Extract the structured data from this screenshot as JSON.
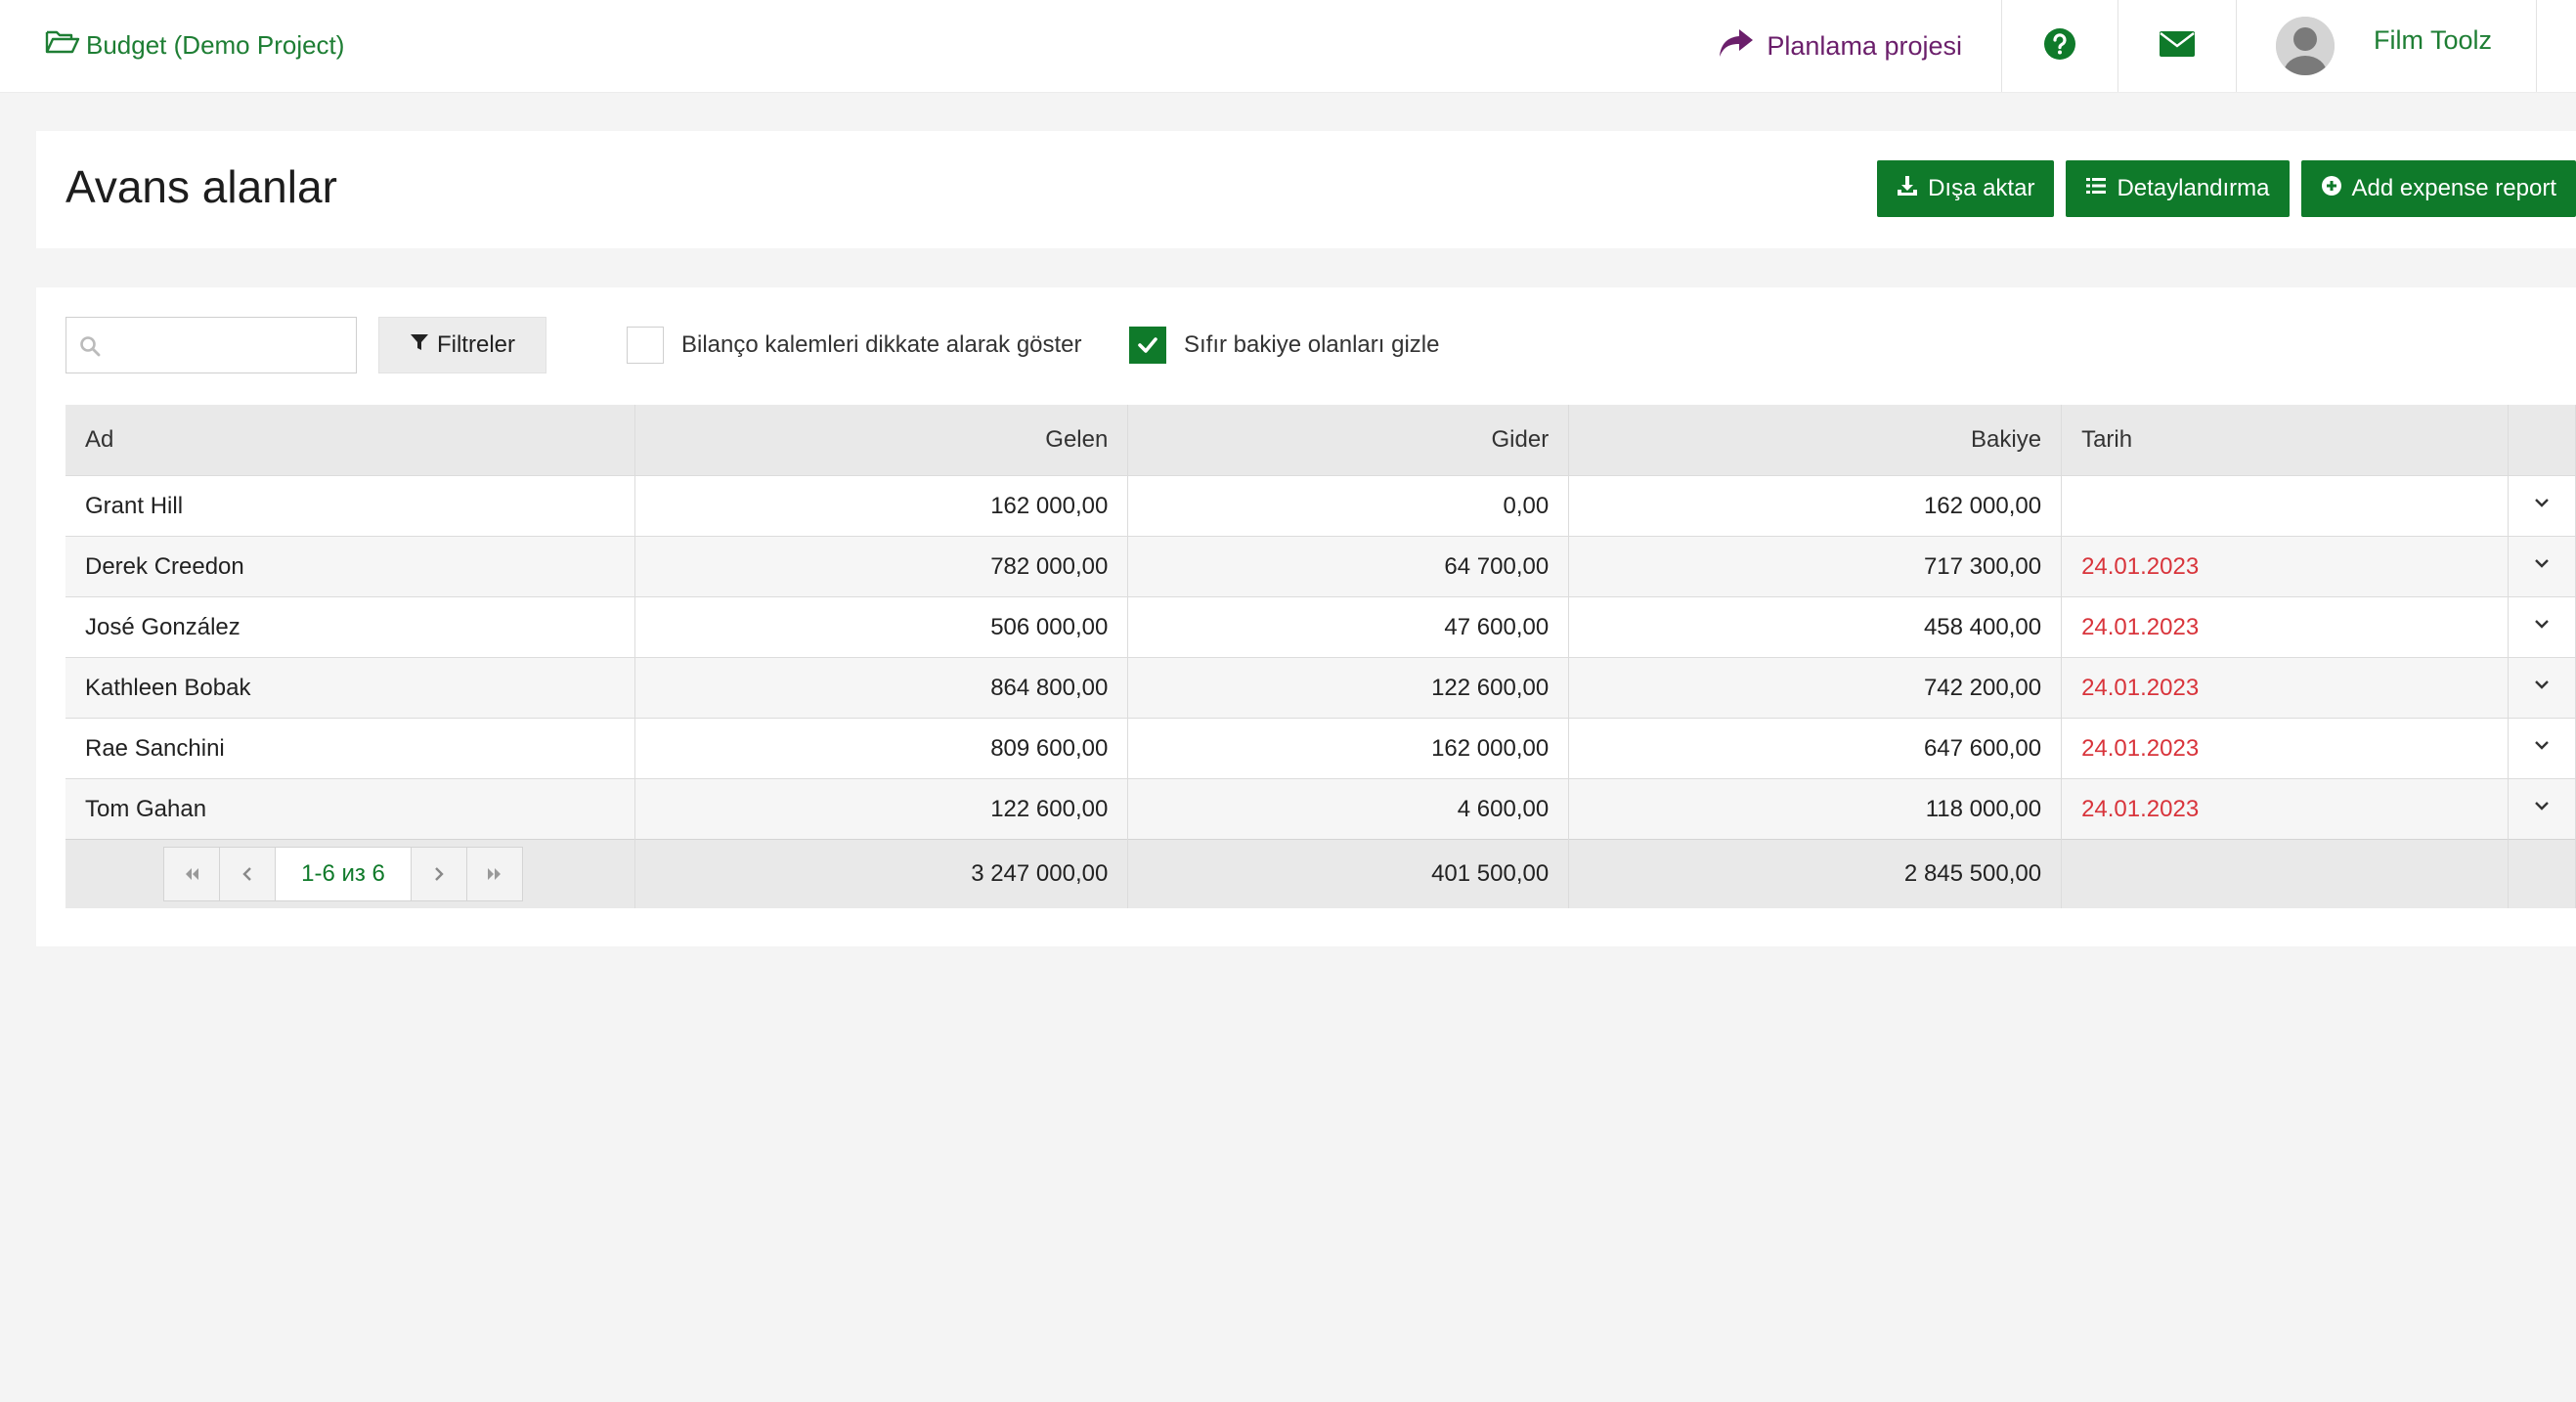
{
  "topbar": {
    "project_label": "Budget (Demo Project)",
    "planning_label": "Planlama projesi",
    "user_name": "Film Toolz"
  },
  "header": {
    "title": "Avans alanlar",
    "buttons": {
      "export": "Dışa aktar",
      "detail": "Detaylandırma",
      "add": "Add expense report"
    }
  },
  "toolbar": {
    "search_value": "",
    "search_placeholder": "",
    "filter_label": "Filtreler",
    "checkbox_balance_label": "Bilanço kalemleri dikkate alarak göster",
    "checkbox_balance_checked": false,
    "checkbox_zero_label": "Sıfır bakiye olanları gizle",
    "checkbox_zero_checked": true
  },
  "table": {
    "columns": [
      "Ad",
      "Gelen",
      "Gider",
      "Bakiye",
      "Tarih"
    ],
    "rows": [
      {
        "name": "Grant Hill",
        "in": "162 000,00",
        "out": "0,00",
        "balance": "162 000,00",
        "date": ""
      },
      {
        "name": "Derek Creedon",
        "in": "782 000,00",
        "out": "64 700,00",
        "balance": "717 300,00",
        "date": "24.01.2023"
      },
      {
        "name": "José González",
        "in": "506 000,00",
        "out": "47 600,00",
        "balance": "458 400,00",
        "date": "24.01.2023"
      },
      {
        "name": "Kathleen Bobak",
        "in": "864 800,00",
        "out": "122 600,00",
        "balance": "742 200,00",
        "date": "24.01.2023"
      },
      {
        "name": "Rae Sanchini",
        "in": "809 600,00",
        "out": "162 000,00",
        "balance": "647 600,00",
        "date": "24.01.2023"
      },
      {
        "name": "Tom Gahan",
        "in": "122 600,00",
        "out": "4 600,00",
        "balance": "118 000,00",
        "date": "24.01.2023"
      }
    ],
    "totals": {
      "in": "3 247 000,00",
      "out": "401 500,00",
      "balance": "2 845 500,00"
    },
    "pager_info": "1-6 из 6"
  },
  "colors": {
    "accent_green": "#0f7a2a",
    "link_green": "#1e7e34",
    "planning_purple": "#6b1f6b",
    "date_red": "#d8343b"
  },
  "icons": {
    "project": "folder-open-icon",
    "planning": "share-arrow-icon",
    "help": "question-circle-icon",
    "mail": "envelope-icon",
    "export": "download-icon",
    "detail": "list-icon",
    "add": "plus-circle-icon",
    "search": "search-icon",
    "filter": "funnel-icon",
    "row_expand": "chevron-down-icon"
  }
}
